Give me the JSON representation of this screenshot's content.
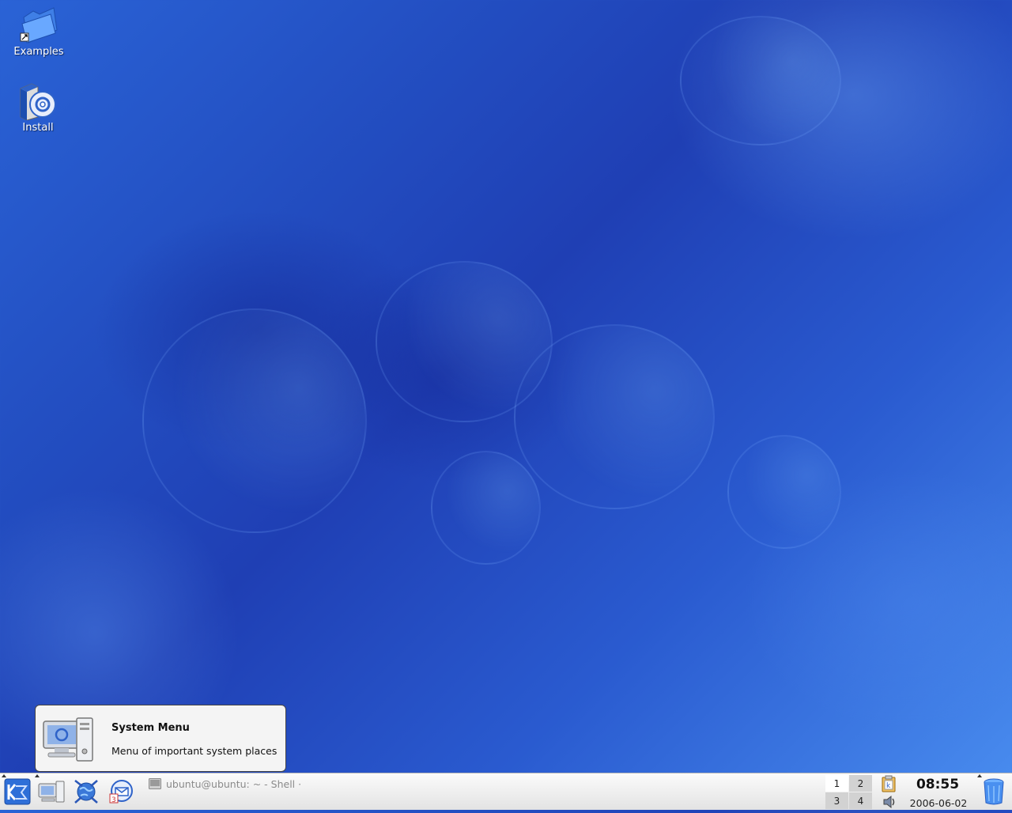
{
  "desktop": {
    "icons": [
      {
        "label": "Examples",
        "icon": "folder-icon"
      },
      {
        "label": "Install",
        "icon": "installer-icon"
      }
    ]
  },
  "tooltip": {
    "title": "System Menu",
    "description": "Menu of important system places"
  },
  "panel": {
    "launchers": [
      "kmenu-icon",
      "system-menu-icon",
      "konqueror-icon",
      "kontact-icon"
    ],
    "task": {
      "label": "ubuntu@ubuntu: ~ - Shell ·"
    },
    "pager": {
      "desktops": [
        "1",
        "2",
        "3",
        "4"
      ],
      "active": "1"
    },
    "tray": [
      "klipper-icon",
      "volume-icon"
    ],
    "clock": {
      "time": "08:55",
      "date": "2006-06-02"
    },
    "trash": "trash-icon"
  },
  "colors": {
    "wallpaper": "#2448c0",
    "panel": "#ececec"
  }
}
